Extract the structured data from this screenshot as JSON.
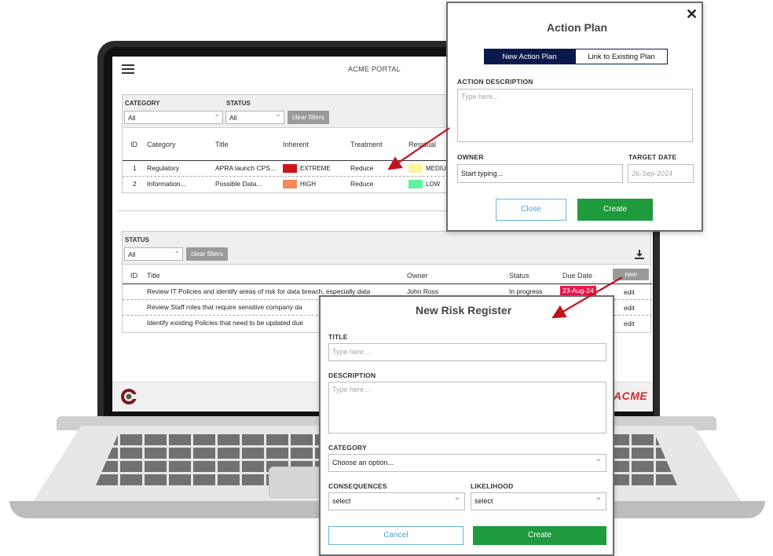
{
  "portal": {
    "title": "ACME PORTAL",
    "brand": "ACME",
    "risk_filters": {
      "category_label": "CATEGORY",
      "category_value": "All",
      "status_label": "STATUS",
      "status_value": "All",
      "clear_label": "clear filters"
    },
    "risk_table": {
      "headers": [
        "ID",
        "Category",
        "Title",
        "Inherent",
        "Treatment",
        "Residual"
      ],
      "rows": [
        {
          "id": "1",
          "category": "Regulatory",
          "title": "APRA launch CPS...",
          "inherent": "EXTREME",
          "inherent_color": "#d0121b",
          "treatment": "Reduce",
          "residual": "MEDIU",
          "residual_color": "#fbf59b"
        },
        {
          "id": "2",
          "category": "Information...",
          "title": "Possible Data...",
          "inherent": "HIGH",
          "inherent_color": "#f4895a",
          "treatment": "Reduce",
          "residual": "LOW",
          "residual_color": "#5ff5a0"
        }
      ]
    },
    "action_filters": {
      "status_label": "STATUS",
      "status_value": "All",
      "clear_label": "clear filters"
    },
    "action_table": {
      "headers": [
        "ID",
        "Title",
        "Owner",
        "Status",
        "Due Date"
      ],
      "new_label": "new",
      "rows": [
        {
          "title": "Review IT Policies and identify areas of risk for data breach, especially data",
          "owner": "John Ross",
          "status": "In progress",
          "due": "23-Aug-24",
          "edit": "edit"
        },
        {
          "title": "Review Staff roles that require sensitive company da",
          "edit": "edit"
        },
        {
          "title": "Identify existing Policies that need to be updated due",
          "edit": "edit"
        }
      ]
    }
  },
  "action_plan": {
    "title": "Action Plan",
    "tab_new": "New Action Plan",
    "tab_link": "Link to Existing Plan",
    "desc_label": "ACTION DESCRIPTION",
    "desc_placeholder": "Type here...",
    "owner_label": "OWNER",
    "owner_value": "Start typing...",
    "target_label": "TARGET DATE",
    "target_value": "26-Sep-2024",
    "cancel": "Close",
    "create": "Create"
  },
  "new_risk": {
    "title": "New Risk Register",
    "title_label": "TITLE",
    "title_placeholder": "Type here...",
    "desc_label": "DESCRIPTION",
    "desc_placeholder": "Type here...",
    "category_label": "CATEGORY",
    "category_value": "Choose an option...",
    "consequences_label": "CONSEQUENCES",
    "consequences_value": "select",
    "likelihood_label": "LIKELIHOOD",
    "likelihood_value": "select",
    "cancel": "Cancel",
    "create": "Create"
  },
  "colors": {
    "accent_navy": "#0b1a4d",
    "create_green": "#1e9b3d",
    "arrow_red": "#c0141a",
    "due_red": "#e8194d"
  }
}
